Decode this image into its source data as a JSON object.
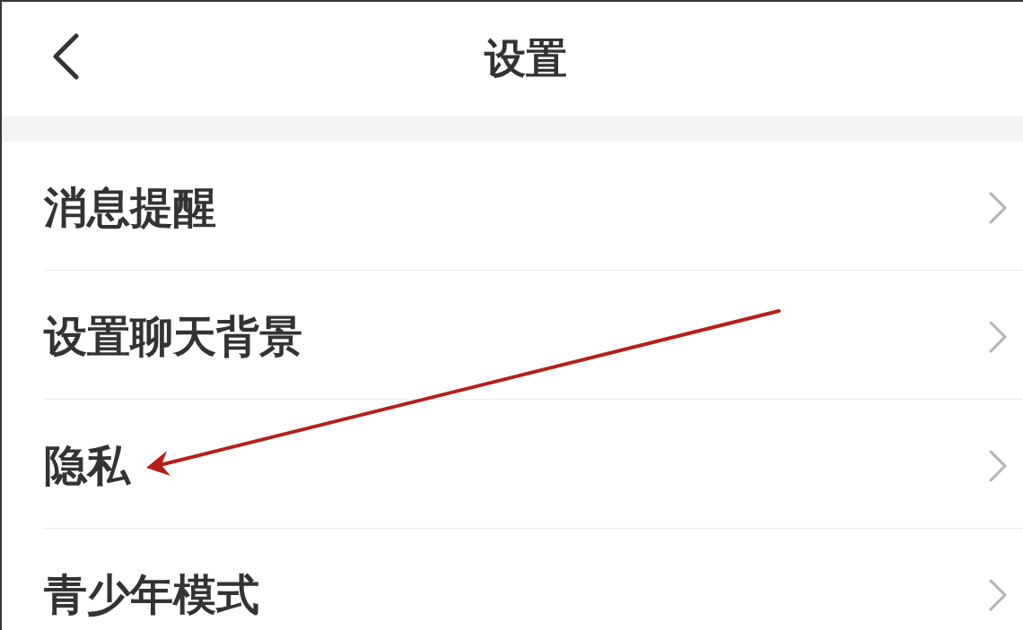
{
  "header": {
    "title": "设置"
  },
  "settings_items": [
    {
      "label": "消息提醒"
    },
    {
      "label": "设置聊天背景"
    },
    {
      "label": "隐私"
    },
    {
      "label": "青少年模式"
    }
  ]
}
